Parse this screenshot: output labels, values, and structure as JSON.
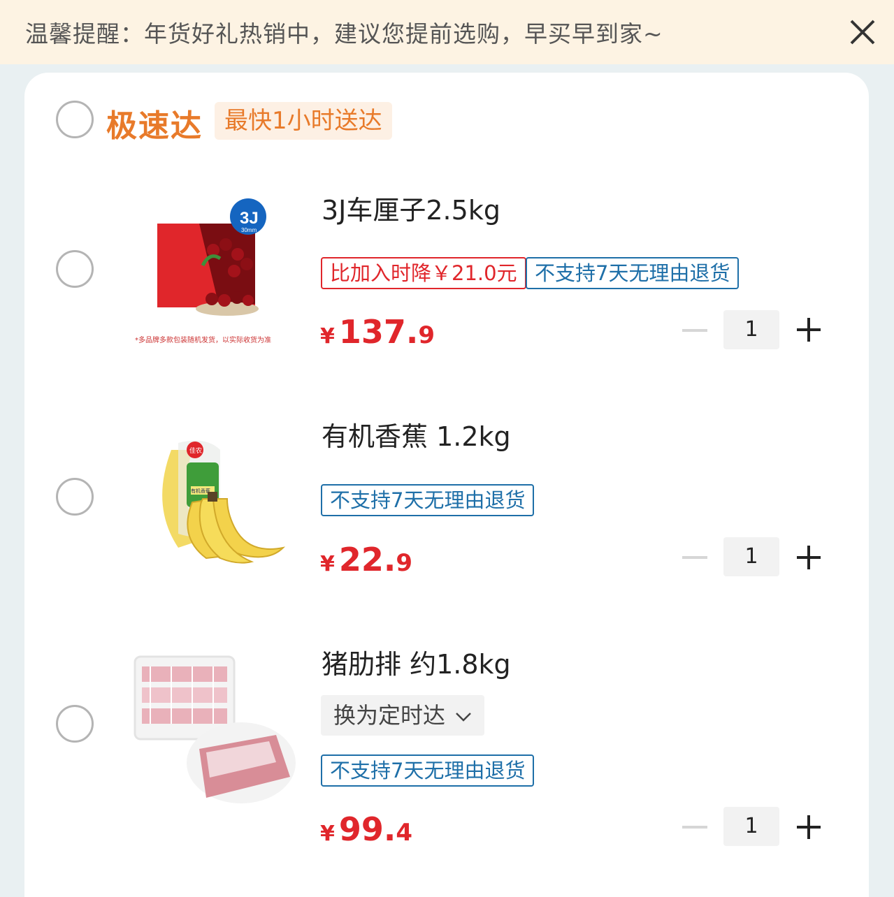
{
  "notice": {
    "text": "温馨提醒：年货好礼热销中，建议您提前选购，早买早到家~",
    "close_icon": "close-icon"
  },
  "group": {
    "title": "极速达",
    "tag": "最快1小时送达",
    "accent_color": "#e87a2a"
  },
  "items": [
    {
      "name": "3J车厘子2.5kg",
      "badge_text": "3J",
      "badge_sub": "30mm",
      "photo_note": "*多品牌多款包装随机发货，以实际收货为准",
      "price_drop_tag": "比加入时降￥21.0元",
      "return_tag": "不支持7天无理由退货",
      "currency": "¥",
      "price_int": "137.",
      "price_dec": "9",
      "qty": "1"
    },
    {
      "name": "有机香蕉 1.2kg",
      "label_text": "佳农",
      "label_sub": "有机香蕉",
      "return_tag": "不支持7天无理由退货",
      "currency": "¥",
      "price_int": "22.",
      "price_dec": "9",
      "qty": "1"
    },
    {
      "name": "猪肋排 约1.8kg",
      "switch_label": "换为定时达",
      "return_tag": "不支持7天无理由退货",
      "currency": "¥",
      "price_int": "99.",
      "price_dec": "4",
      "qty": "1"
    }
  ],
  "colors": {
    "price": "#e0262b",
    "tag_blue": "#1e6fa8",
    "notice_bg": "#fdf3e3"
  }
}
